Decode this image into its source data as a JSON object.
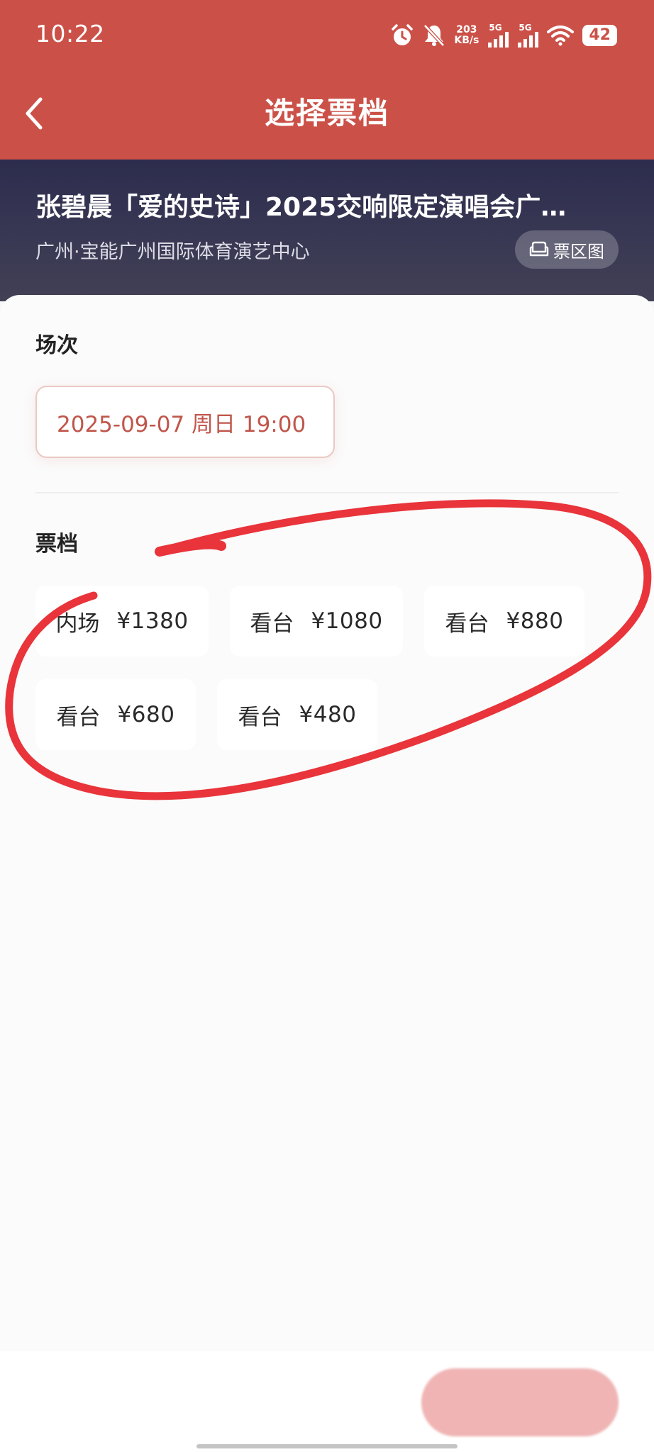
{
  "status_bar": {
    "time": "10:22",
    "net_speed_value": "203",
    "net_speed_unit": "KB/s",
    "signal_1": "5G",
    "signal_2": "5G",
    "battery": "42"
  },
  "header": {
    "title": "选择票档",
    "back_icon": "chevron-left-icon"
  },
  "event": {
    "title": "张碧晨「爱的史诗」2025交响限定演唱会广…",
    "venue": "广州·宝能广州国际体育演艺中心",
    "seat_map_label": "票区图"
  },
  "session": {
    "label": "场次",
    "selected": "2025-09-07 周日 19:00"
  },
  "tiers": {
    "label": "票档",
    "items": [
      {
        "area": "内场",
        "price": "¥1380"
      },
      {
        "area": "看台",
        "price": "¥1080"
      },
      {
        "area": "看台",
        "price": "¥880"
      },
      {
        "area": "看台",
        "price": "¥680"
      },
      {
        "area": "看台",
        "price": "¥480"
      }
    ]
  },
  "colors": {
    "header_red": "#cb5148",
    "banner_navy": "#2c2c4e",
    "session_text": "#c0564b",
    "annotation_red": "#e8343a",
    "confirm_disabled": "#f0b4b4"
  }
}
